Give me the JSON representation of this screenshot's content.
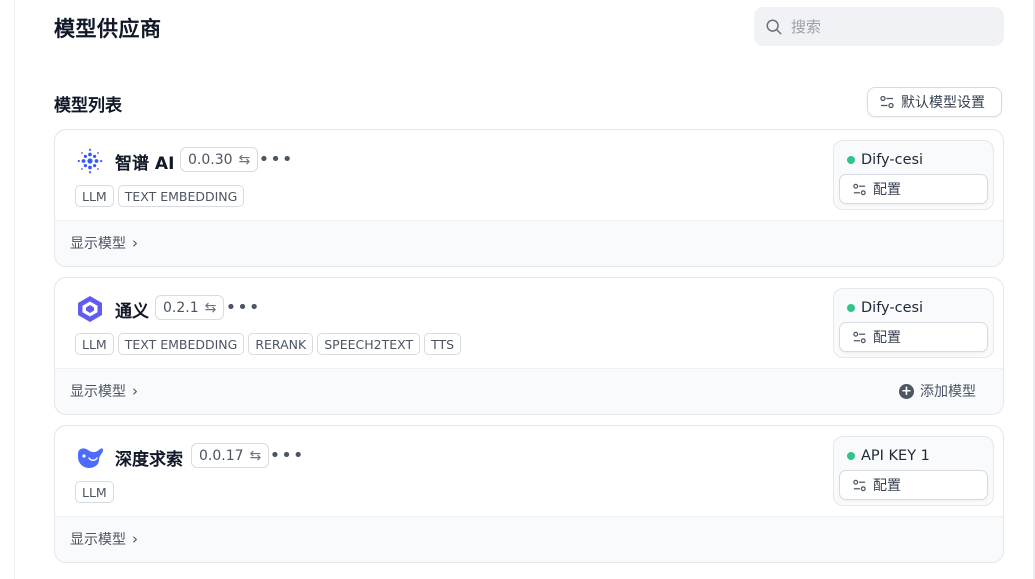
{
  "page_title": "模型供应商",
  "search": {
    "placeholder": "搜索"
  },
  "section_title": "模型列表",
  "default_button_label": "默认模型设置",
  "providers": [
    {
      "name": "智谱 AI",
      "version": "0.0.30",
      "tags": [
        "LLM",
        "TEXT EMBEDDING"
      ],
      "show_models_label": "显示模型",
      "credential": "Dify-cesi",
      "config_label": "配置",
      "icon": "zhipu-logo-icon"
    },
    {
      "name": "通义",
      "version": "0.2.1",
      "tags": [
        "LLM",
        "TEXT EMBEDDING",
        "RERANK",
        "SPEECH2TEXT",
        "TTS"
      ],
      "show_models_label": "显示模型",
      "add_model_label": "添加模型",
      "credential": "Dify-cesi",
      "config_label": "配置",
      "icon": "tongyi-logo-icon"
    },
    {
      "name": "深度求索",
      "version": "0.0.17",
      "tags": [
        "LLM"
      ],
      "show_models_label": "显示模型",
      "credential": "API KEY 1",
      "config_label": "配置",
      "icon": "deepseek-logo-icon"
    }
  ],
  "colors": {
    "status_active": "#31c48d",
    "zhipu_brand": "#3859ff",
    "tongyi_brand": "#615ced",
    "deepseek_brand": "#4d6bfe"
  }
}
